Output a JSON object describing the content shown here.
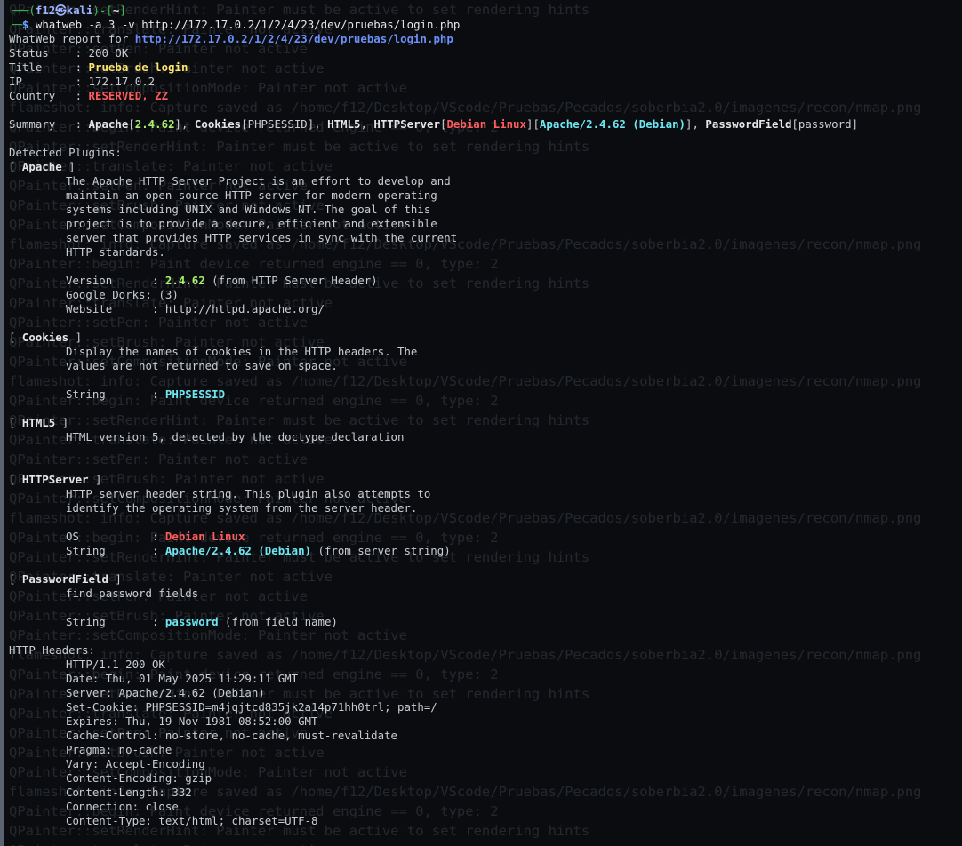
{
  "prompt": {
    "user": "f12",
    "at": "㉿",
    "host": "kali",
    "cwd": "~",
    "symbol": "$",
    "command": "whatweb -a 3 -v http://172.17.0.2/1/2/4/23/dev/pruebas/login.php"
  },
  "report": {
    "header_label": "WhatWeb report for ",
    "url": "http://172.17.0.2/1/2/4/23/dev/pruebas/login.php",
    "fields": [
      {
        "label": "Status    : ",
        "value": "200 OK"
      },
      {
        "label": "Title     : ",
        "value": "Prueba de login"
      },
      {
        "label": "IP        : ",
        "value": "172.17.0.2"
      },
      {
        "label": "Country   : ",
        "value": "RESERVED, ZZ"
      }
    ],
    "summary_label": "Summary   : ",
    "summary": {
      "apache": "Apache",
      "apache_ver": "2.4.62",
      "cookies": "Cookies",
      "cookies_val": "PHPSESSID",
      "html5": "HTML5",
      "httpserver": "HTTPServer",
      "os": "Debian Linux",
      "server": "Apache/2.4.62 (Debian)",
      "pwfield": "PasswordField",
      "pwfield_val": "password"
    },
    "detected_label": "Detected Plugins:"
  },
  "plugins": {
    "apache": {
      "name": "Apache",
      "desc": [
        "The Apache HTTP Server Project is an effort to develop and",
        "maintain an open-source HTTP server for modern operating",
        "systems including UNIX and Windows NT. The goal of this",
        "project is to provide a secure, efficient and extensible",
        "server that provides HTTP services in sync with the current",
        "HTTP standards."
      ],
      "version_label": "Version      : ",
      "version": "2.4.62",
      "version_note": " (from HTTP Server Header)",
      "dorks": "Google Dorks: (3)",
      "website": "Website      : http://httpd.apache.org/"
    },
    "cookies": {
      "name": "Cookies",
      "desc": [
        "Display the names of cookies in the HTTP headers. The",
        "values are not returned to save on space."
      ],
      "string_label": "String       : ",
      "string": "PHPSESSID"
    },
    "html5": {
      "name": "HTML5",
      "desc": [
        "HTML version 5, detected by the doctype declaration"
      ]
    },
    "httpserver": {
      "name": "HTTPServer",
      "desc": [
        "HTTP server header string. This plugin also attempts to",
        "identify the operating system from the server header."
      ],
      "os_label": "OS           : ",
      "os": "Debian Linux",
      "string_label": "String       : ",
      "string": "Apache/2.4.62 (Debian)",
      "string_note": " (from server string)"
    },
    "passwordfield": {
      "name": "PasswordField",
      "desc": [
        "find password fields"
      ],
      "string_label": "String       : ",
      "string": "password",
      "string_note": " (from field name)"
    }
  },
  "http_headers": {
    "label": "HTTP Headers:",
    "lines": [
      "HTTP/1.1 200 OK",
      "Date: Thu, 01 May 2025 11:29:11 GMT",
      "Server: Apache/2.4.62 (Debian)",
      "Set-Cookie: PHPSESSID=m4jqjtcd835jk2a14p71hh0trl; path=/",
      "Expires: Thu, 19 Nov 1981 08:52:00 GMT",
      "Cache-Control: no-store, no-cache, must-revalidate",
      "Pragma: no-cache",
      "Vary: Accept-Encoding",
      "Content-Encoding: gzip",
      "Content-Length: 332",
      "Connection: close",
      "Content-Type: text/html; charset=UTF-8"
    ]
  },
  "ghost_lines": [
    "QPainter::setRenderHint: Painter must be active to set rendering hints",
    "QPainter::translate: Painter not active",
    "QPainter::setPen: Painter not active",
    "QPainter::setBrush: Painter not active",
    "QPainter::setCompositionMode: Painter not active",
    "flameshot: info: Capture saved as /home/f12/Desktop/VScode/Pruebas/Pecados/soberbia2.0/imagenes/recon/nmap.png",
    "QPainter::begin: Paint device returned engine == 0, type: 2"
  ],
  "colors": {
    "background": "#0a0c10",
    "text": "#c9cdd2",
    "url": "#6d8ff8",
    "title": "#ffe66b",
    "country": "#ff5c5c",
    "cyan": "#6fe6f2",
    "green": "#a9f06c"
  }
}
